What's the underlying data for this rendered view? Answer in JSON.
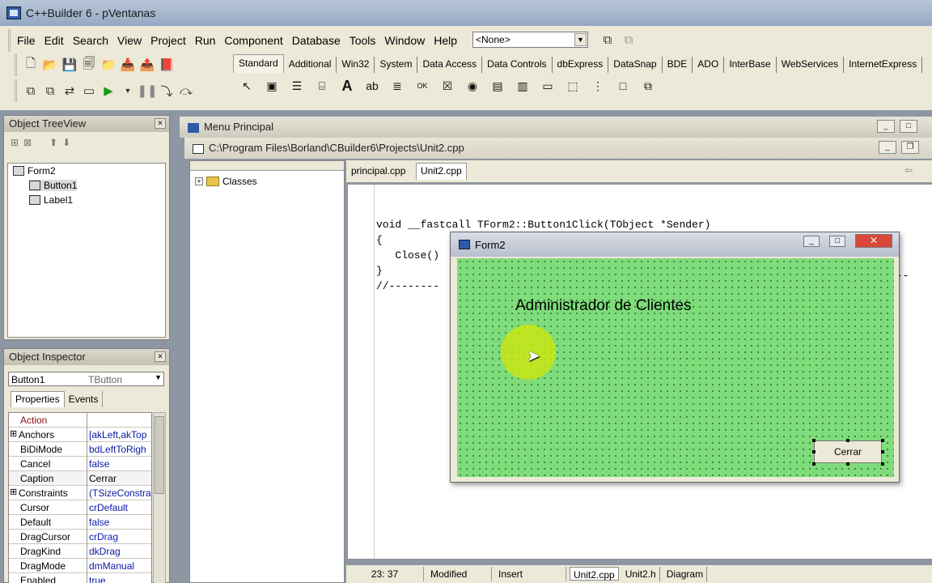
{
  "window": {
    "title": "C++Builder 6 - pVentanas"
  },
  "menu": [
    "File",
    "Edit",
    "Search",
    "View",
    "Project",
    "Run",
    "Component",
    "Database",
    "Tools",
    "Window",
    "Help"
  ],
  "combo": {
    "value": "<None>"
  },
  "palette_tabs": [
    "Standard",
    "Additional",
    "Win32",
    "System",
    "Data Access",
    "Data Controls",
    "dbExpress",
    "DataSnap",
    "BDE",
    "ADO",
    "InterBase",
    "WebServices",
    "InternetExpress"
  ],
  "tree_view": {
    "title": "Object TreeView",
    "items": [
      "Form2",
      "Button1",
      "Label1"
    ]
  },
  "inspector": {
    "title": "Object Inspector",
    "object": "Button1",
    "object_type": "TButton",
    "tabs": [
      "Properties",
      "Events"
    ],
    "rows": [
      {
        "name": "Action",
        "value": ""
      },
      {
        "name": "Anchors",
        "value": "[akLeft,akTop"
      },
      {
        "name": "BiDiMode",
        "value": "bdLeftToRigh"
      },
      {
        "name": "Cancel",
        "value": "false"
      },
      {
        "name": "Caption",
        "value": "Cerrar"
      },
      {
        "name": "Constraints",
        "value": "(TSizeConstra"
      },
      {
        "name": "Cursor",
        "value": "crDefault"
      },
      {
        "name": "Default",
        "value": "false"
      },
      {
        "name": "DragCursor",
        "value": "crDrag"
      },
      {
        "name": "DragKind",
        "value": "dkDrag"
      },
      {
        "name": "DragMode",
        "value": "dmManual"
      },
      {
        "name": "Enabled",
        "value": "true"
      }
    ]
  },
  "mdi": {
    "title": "Menu Principal"
  },
  "editor": {
    "path": "C:\\Program Files\\Borland\\CBuilder6\\Projects\\Unit2.cpp",
    "tabs": [
      "principal.cpp",
      "Unit2.cpp"
    ],
    "class_tree": "Classes",
    "code_lines": [
      "void __fastcall TForm2::Button1Click(TObject *Sender)",
      "{",
      "   Close()",
      "}",
      "//--------"
    ],
    "status": {
      "position": "23:  37",
      "modified": "Modified",
      "mode": "Insert"
    },
    "bottom_tabs": [
      "Unit2.cpp",
      "Unit2.h",
      "Diagram"
    ]
  },
  "form2": {
    "title": "Form2",
    "label": "Administrador de Clientes",
    "button": "Cerrar"
  }
}
